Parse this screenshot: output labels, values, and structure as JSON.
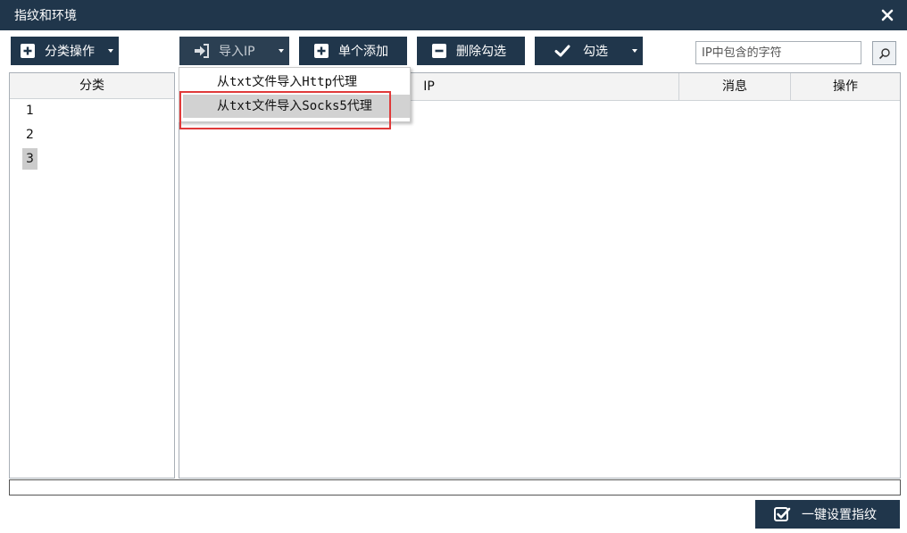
{
  "window": {
    "title": "指纹和环境",
    "close_icon": "close-icon"
  },
  "toolbar": {
    "category_ops": {
      "label": "分类操作",
      "icon": "plus-square-icon"
    },
    "import_ip": {
      "label": "导入IP",
      "icon": "sign-in-icon"
    },
    "add_single": {
      "label": "单个添加",
      "icon": "plus-square-icon"
    },
    "delete_checked": {
      "label": "删除勾选",
      "icon": "minus-square-icon"
    },
    "check": {
      "label": "勾选",
      "icon": "check-icon"
    },
    "search": {
      "placeholder": "IP中包含的字符",
      "value": "",
      "icon": "search-icon"
    }
  },
  "left_panel": {
    "header": "分类",
    "items": [
      {
        "label": "1",
        "selected": false
      },
      {
        "label": "2",
        "selected": false
      },
      {
        "label": "3",
        "selected": true
      }
    ]
  },
  "table": {
    "columns": [
      "IP",
      "消息",
      "操作"
    ],
    "rows": []
  },
  "import_menu": {
    "items": [
      {
        "label": "从txt文件导入Http代理"
      },
      {
        "label": "从txt文件导入Socks5代理"
      }
    ],
    "hovered_index": 1
  },
  "footer": {
    "one_click": {
      "label": "一键设置指纹",
      "icon": "checkbox-checked-icon"
    }
  },
  "colors": {
    "primary": "#20364b",
    "highlight": "#e03a3a",
    "selected": "#cccccc"
  }
}
